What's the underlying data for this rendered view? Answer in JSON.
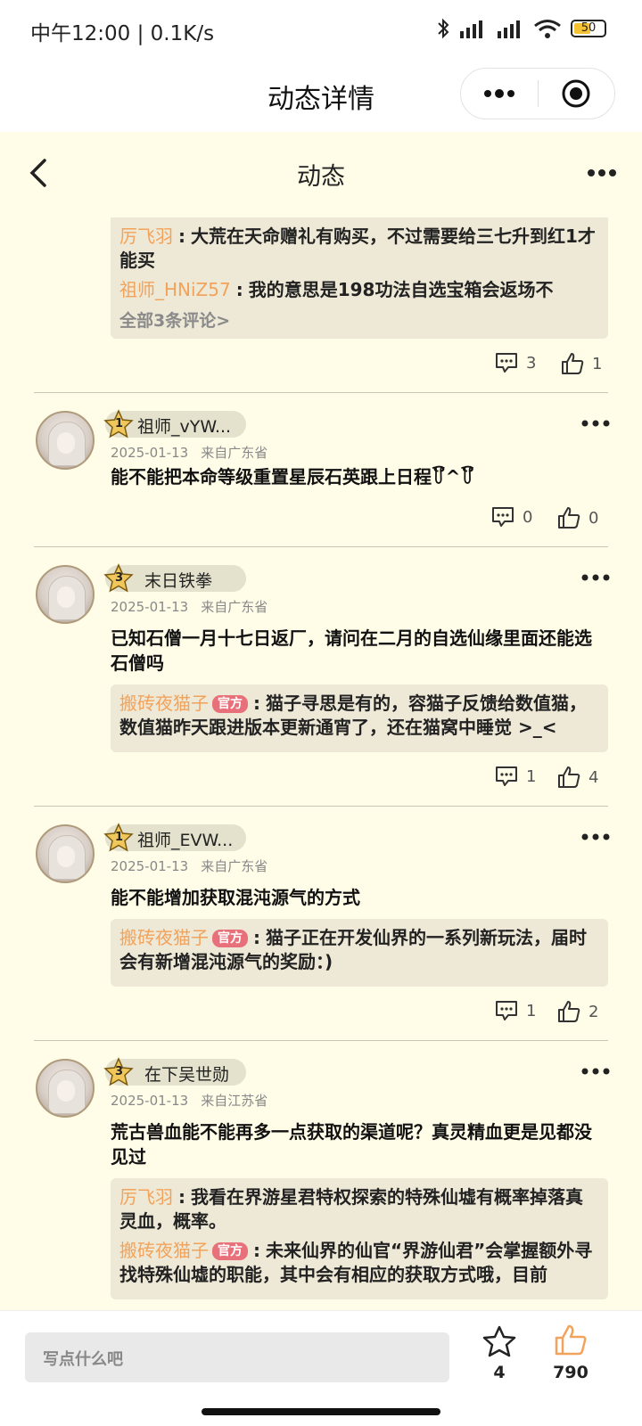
{
  "status_bar": {
    "time_speed": "中午12:00 | 0.1K/s",
    "battery": "50"
  },
  "miniprogram": {
    "title": "动态详情"
  },
  "nav": {
    "title": "动态"
  },
  "top_post": {
    "replies": [
      {
        "name": "厉飞羽",
        "text": "大荒在天命赠礼有购买，不过需要给三七升到红1才能买"
      },
      {
        "name": "祖师_HNiZ57",
        "text": "我的意思是198功法自选宝箱会返场不"
      }
    ],
    "all_comments": "全部3条评论>",
    "comment_count": "3",
    "like_count": "1"
  },
  "posts": [
    {
      "level": "1",
      "name": "祖师_vYW...",
      "date": "2025-01-13",
      "location": "来自广东省",
      "content": "能不能把本命等级重置星辰石英跟上日程꒦ິ^꒦ິ",
      "replies": [],
      "comment_count": "0",
      "like_count": "0"
    },
    {
      "level": "3",
      "name": "末日铁拳",
      "date": "2025-01-13",
      "location": "来自广东省",
      "content": "已知石僧一月十七日返厂，请问在二月的自选仙缘里面还能选石僧吗",
      "replies": [
        {
          "name": "搬砖夜猫子",
          "badge": "官方",
          "text": "猫子寻思是有的，容猫子反馈给数值猫，数值猫昨天跟进版本更新通宵了，还在猫窝中睡觉 >_<"
        }
      ],
      "comment_count": "1",
      "like_count": "4"
    },
    {
      "level": "1",
      "name": "祖师_EVW...",
      "date": "2025-01-13",
      "location": "来自广东省",
      "content": "能不能增加获取混沌源气的方式",
      "replies": [
        {
          "name": "搬砖夜猫子",
          "badge": "官方",
          "text": "猫子正在开发仙界的一系列新玩法，届时会有新增混沌源气的奖励：)"
        }
      ],
      "comment_count": "1",
      "like_count": "2"
    },
    {
      "level": "3",
      "name": "在下吴世勋",
      "date": "2025-01-13",
      "location": "来自江苏省",
      "content": "荒古兽血能不能再多一点获取的渠道呢？真灵精血更是见都没见过",
      "replies": [
        {
          "name": "厉飞羽",
          "text": "我看在界游星君特权探索的特殊仙墟有概率掉落真灵血，概率。"
        },
        {
          "name": "搬砖夜猫子",
          "badge": "官方",
          "text": "未来仙界的仙官“界游仙君”会掌握额外寻找特殊仙墟的职能，其中会有相应的获取方式哦，目前"
        }
      ]
    }
  ],
  "bottom": {
    "placeholder": "写点什么吧",
    "fav_count": "4",
    "like_count": "790"
  },
  "colors": {
    "accent_orange": "#f2a35b",
    "official_badge": "#e8707a",
    "page_bg": "#fffde7",
    "reply_bg": "#eee8d6"
  }
}
